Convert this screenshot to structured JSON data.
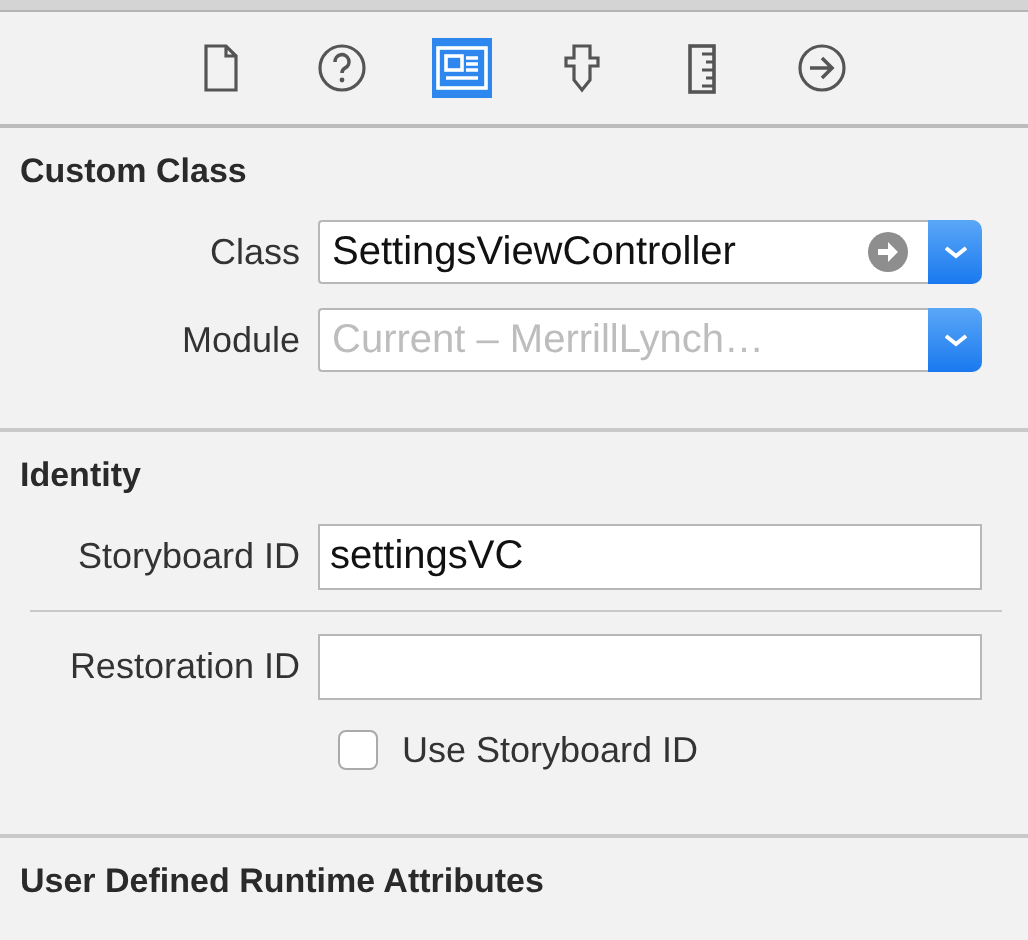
{
  "toolbar": {
    "tabs": [
      {
        "kind": "file",
        "selected": false
      },
      {
        "kind": "help",
        "selected": false
      },
      {
        "kind": "identity",
        "selected": true
      },
      {
        "kind": "attributes",
        "selected": false
      },
      {
        "kind": "size",
        "selected": false
      },
      {
        "kind": "connections",
        "selected": false
      }
    ]
  },
  "custom_class": {
    "title": "Custom Class",
    "fields": [
      {
        "label": "Class",
        "value": "SettingsViewController",
        "kind": "combo-arrow"
      },
      {
        "label": "Module",
        "placeholder": "Current – MerrillLynch…",
        "kind": "combo"
      }
    ]
  },
  "identity": {
    "title": "Identity",
    "fields": [
      {
        "label": "Storyboard ID",
        "value": "settingsVC"
      },
      {
        "label": "Restoration ID"
      }
    ],
    "checkbox": {
      "label": "Use Storyboard ID",
      "checked": false
    }
  },
  "runtime_attributes": {
    "title": "User Defined Runtime Attributes"
  }
}
